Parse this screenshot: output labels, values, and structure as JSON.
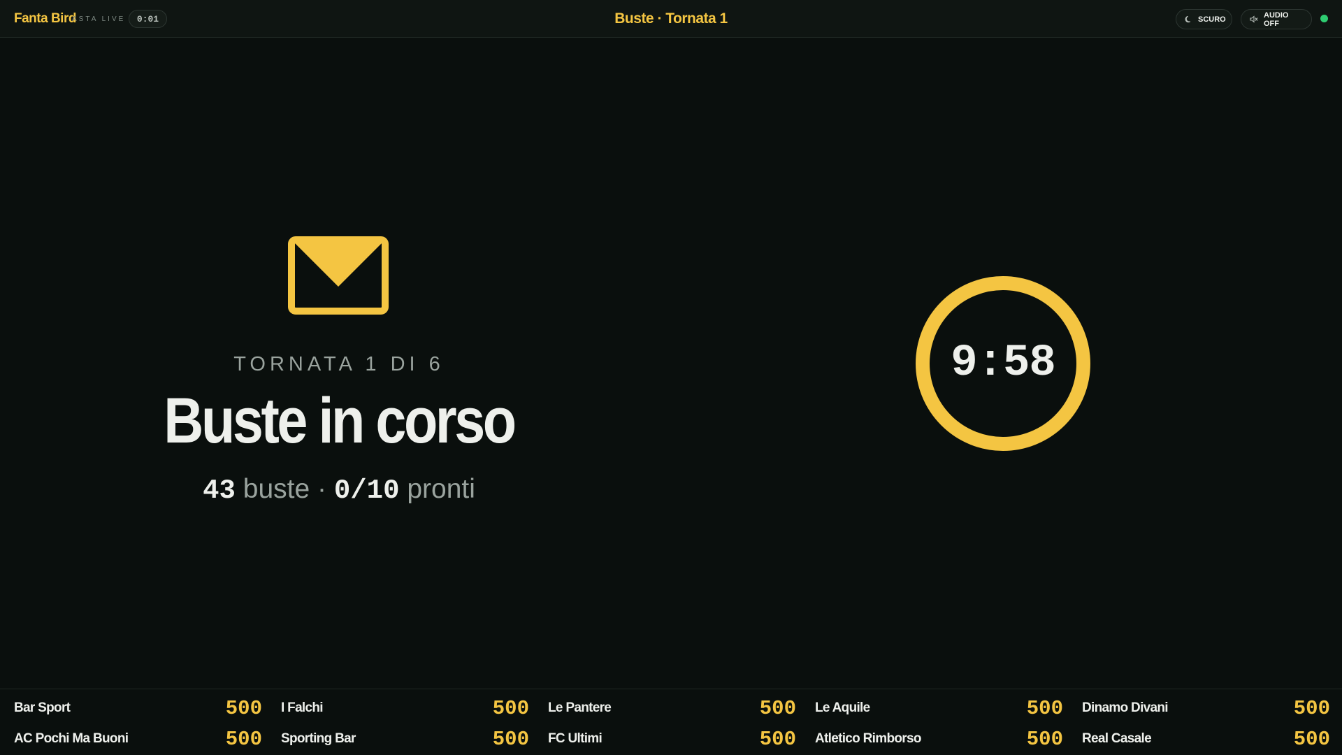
{
  "header": {
    "brand": "Fanta Bird",
    "live_tag": "ASTA LIVE",
    "elapsed": "0:01",
    "title": "Buste · Tornata 1",
    "theme_button": "SCURO",
    "audio_button": "AUDIO OFF",
    "connection_status_color": "#2ecc71"
  },
  "stage": {
    "icon": "envelope-icon",
    "round_label": "TORNATA 1 DI 6",
    "headline": "Buste in corso",
    "envelopes_count": "43",
    "envelopes_label": "buste",
    "separator": "·",
    "ready_count": "0/10",
    "ready_label": "pronti",
    "timer": "9:58"
  },
  "standings": [
    {
      "name": "Bar Sport",
      "credits": "500"
    },
    {
      "name": "I Falchi",
      "credits": "500"
    },
    {
      "name": "Le Pantere",
      "credits": "500"
    },
    {
      "name": "Le Aquile",
      "credits": "500"
    },
    {
      "name": "Dinamo Divani",
      "credits": "500"
    },
    {
      "name": "AC Pochi Ma Buoni",
      "credits": "500"
    },
    {
      "name": "Sporting Bar",
      "credits": "500"
    },
    {
      "name": "FC Ultimi",
      "credits": "500"
    },
    {
      "name": "Atletico Rimborso",
      "credits": "500"
    },
    {
      "name": "Real Casale",
      "credits": "500"
    }
  ],
  "colors": {
    "accent": "#f4c542",
    "background": "#0a0f0d",
    "text": "#eef0ec",
    "muted": "#9aa39e"
  }
}
